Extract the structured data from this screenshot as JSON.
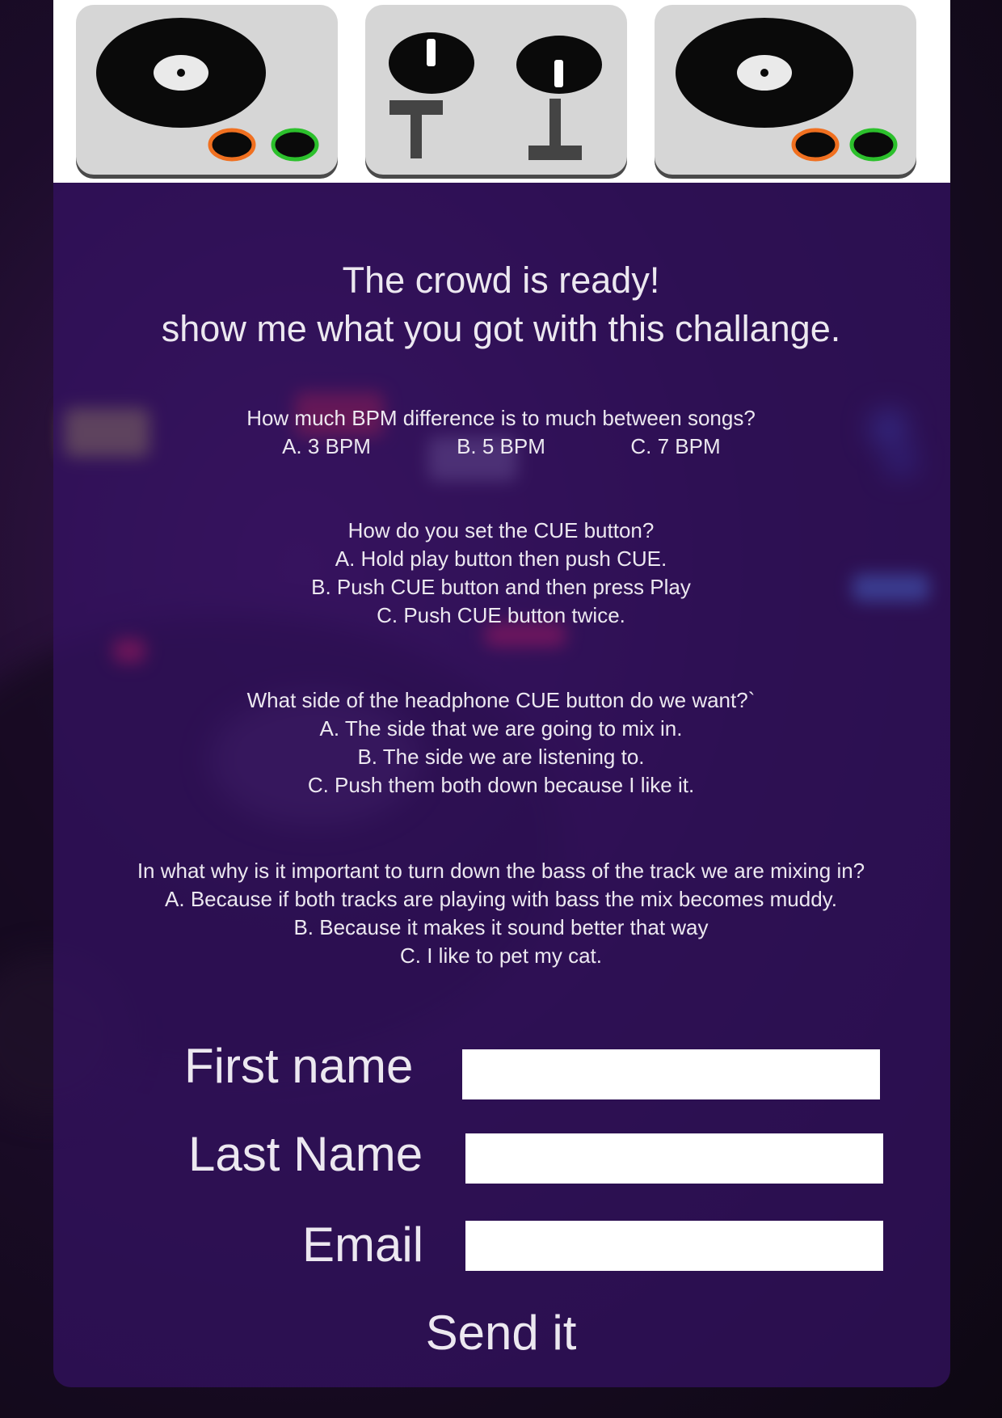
{
  "headline": {
    "line1": "The crowd is ready!",
    "line2": "show me what you got with this challange."
  },
  "questions": [
    {
      "text": "How much BPM difference is to much between songs?",
      "options": [
        "A. 3 BPM",
        "B. 5 BPM",
        "C. 7 BPM"
      ]
    },
    {
      "text": "How do you set the CUE button?",
      "options": [
        "A. Hold play button then push CUE.",
        "B. Push CUE button and then press Play",
        "C. Push CUE button twice."
      ]
    },
    {
      "text": "What side of the headphone CUE button do we want?`",
      "options": [
        "A. The side that we are going to mix in.",
        "B. The side we are listening to.",
        "C. Push them both down because I like it."
      ]
    },
    {
      "text": "In what why is it important to turn down the bass of the track we are mixing in?",
      "options": [
        "A. Because if both tracks are playing with bass the mix becomes muddy.",
        "B. Because it makes it sound better that way",
        "C. I like to pet my cat."
      ]
    }
  ],
  "form": {
    "first_name_label": "First name",
    "last_name_label": "Last Name",
    "email_label": "Email",
    "first_name_value": "",
    "last_name_value": "",
    "email_value": "",
    "submit_label": "Send it"
  },
  "header_icons": [
    "turntable-icon",
    "mixer-icon",
    "turntable-icon"
  ],
  "colors": {
    "panel": "#341264",
    "text": "#ece8f0",
    "deck": "#d6d6d6",
    "record": "#0a0a0a",
    "knob_orange": "#f07020",
    "knob_green": "#2cc02c"
  }
}
